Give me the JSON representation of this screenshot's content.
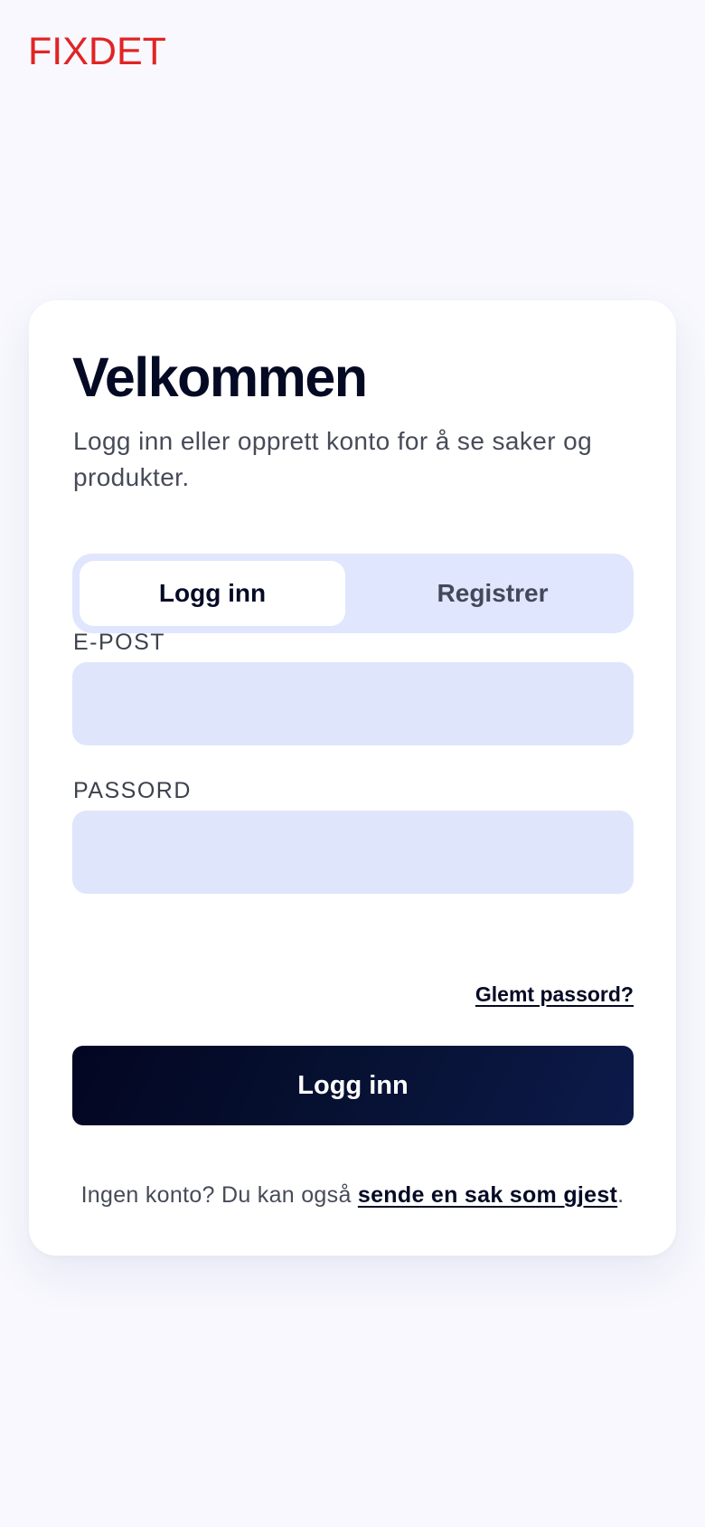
{
  "brand": {
    "logo_text": "FIXDET",
    "logo_color": "#e02424"
  },
  "card": {
    "title": "Velkommen",
    "subtitle": "Logg inn eller opprett konto for å se saker og produkter."
  },
  "tabs": [
    {
      "label": "Logg inn",
      "active": true
    },
    {
      "label": "Registrer",
      "active": false
    }
  ],
  "form": {
    "email_label": "E-POST",
    "email_value": "",
    "password_label": "PASSORD",
    "password_value": "",
    "forgot_label": "Glemt passord?",
    "submit_label": "Logg inn"
  },
  "footer": {
    "prefix": "Ingen konto? Du kan også ",
    "link_label": "sende en sak som gjest",
    "suffix": "."
  },
  "colors": {
    "background": "#f8f8fe",
    "card": "#ffffff",
    "input_bg": "#dfe6fc",
    "primary_dark": "#050a24"
  }
}
